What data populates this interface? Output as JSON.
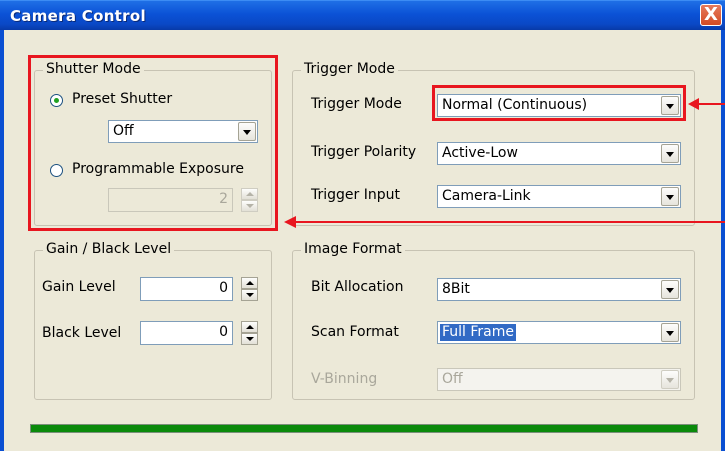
{
  "window": {
    "title": "Camera Control",
    "close_glyph": "X"
  },
  "shutter_mode": {
    "legend": "Shutter Mode",
    "preset_label": "Preset Shutter",
    "preset_checked": true,
    "preset_value": "Off",
    "programmable_label": "Programmable Exposure",
    "programmable_checked": false,
    "exposure_value": "2"
  },
  "trigger_mode": {
    "legend": "Trigger Mode",
    "mode_label": "Trigger Mode",
    "mode_value": "Normal (Continuous)",
    "polarity_label": "Trigger Polarity",
    "polarity_value": "Active-Low",
    "input_label": "Trigger Input",
    "input_value": "Camera-Link"
  },
  "gain_black": {
    "legend": "Gain / Black Level",
    "gain_label": "Gain Level",
    "gain_value": "0",
    "black_label": "Black Level",
    "black_value": "0"
  },
  "image_format": {
    "legend": "Image Format",
    "bit_label": "Bit Allocation",
    "bit_value": "8Bit",
    "scan_label": "Scan Format",
    "scan_value": "Full Frame",
    "vbin_label": "V-Binning",
    "vbin_value": "Off"
  },
  "progress": {
    "fraction": 1.0
  },
  "colors": {
    "title_bar": "#0b52d6",
    "highlight_box": "#e8161f",
    "progress_fill": "#0a8a0a",
    "selection": "#316ac5"
  },
  "icons": {
    "close": "close-icon",
    "dropdown": "chevron-down-icon",
    "spin_up": "spin-up-icon",
    "spin_down": "spin-down-icon"
  }
}
